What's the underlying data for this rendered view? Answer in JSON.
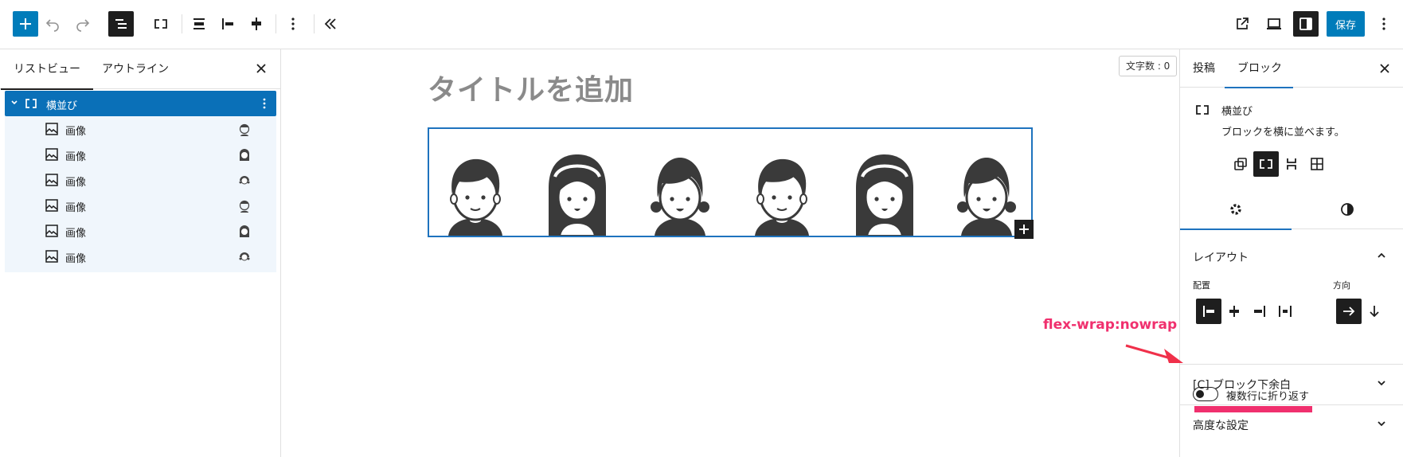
{
  "toolbar": {
    "icons": [
      "plus-icon",
      "undo-icon",
      "redo-icon",
      "list-view-icon",
      "row-block-icon",
      "align-icon",
      "justify-left-icon",
      "justify-center-icon",
      "more-vertical-icon",
      "collapse-icon",
      "external-link-icon",
      "preview-desktop-icon",
      "settings-sidebar-icon",
      "options-icon"
    ],
    "save_label": "保存"
  },
  "left_panel": {
    "tabs": [
      {
        "label": "リストビュー",
        "active": true
      },
      {
        "label": "アウトライン",
        "active": false
      }
    ],
    "tree": {
      "parent": {
        "label": "横並び"
      },
      "children": [
        {
          "label": "画像",
          "thumb": "boy"
        },
        {
          "label": "画像",
          "thumb": "girl-long"
        },
        {
          "label": "画像",
          "thumb": "girl-short"
        },
        {
          "label": "画像",
          "thumb": "boy"
        },
        {
          "label": "画像",
          "thumb": "girl-long"
        },
        {
          "label": "画像",
          "thumb": "girl-short"
        }
      ]
    }
  },
  "canvas": {
    "title_placeholder": "タイトルを追加",
    "word_count": "文字数 : 0",
    "avatars": [
      "boy",
      "girl-long",
      "girl-short",
      "boy",
      "girl-long",
      "girl-short"
    ]
  },
  "sidebar": {
    "tabs": [
      {
        "label": "投稿",
        "active": false
      },
      {
        "label": "ブロック",
        "active": true
      }
    ],
    "block_card": {
      "title": "横並び",
      "description": "ブロックを横に並べます。"
    },
    "variations": [
      "group-icon",
      "row-icon",
      "stack-icon",
      "grid-icon"
    ],
    "settings_tabs": [
      "settings-gear-icon",
      "styles-contrast-icon"
    ],
    "layout_panel": {
      "title": "レイアウト",
      "justification_label": "配置",
      "orientation_label": "方向",
      "wrap_toggle": {
        "label": "複数行に折り返す",
        "checked": false
      }
    },
    "panels": [
      {
        "title": "[C] ブロック下余白"
      },
      {
        "title": "高度な設定"
      }
    ]
  },
  "annotation": {
    "text": "flex-wrap:nowrap",
    "color": "#f0306e"
  },
  "colors": {
    "accent": "#007cba",
    "highlight": "#f0306e",
    "selected_row": "#0a70b8"
  }
}
